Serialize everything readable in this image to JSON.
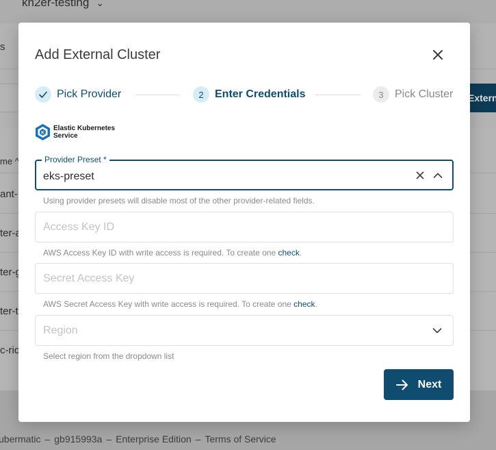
{
  "background": {
    "project_name": "kn2er-testing",
    "tab_partial": "s",
    "external_button_partial": "Extern",
    "column_header_partial": "me",
    "rows_partial": [
      "ant-",
      "ter-a",
      "ter-g",
      "ter-t",
      "c-ric"
    ],
    "footer": [
      "ubermatic",
      "gb915993a",
      "Enterprise Edition",
      "Terms of Service"
    ]
  },
  "dialog": {
    "title": "Add External Cluster",
    "steps": [
      {
        "number": "1",
        "label": "Pick Provider",
        "state": "done"
      },
      {
        "number": "2",
        "label": "Enter Credentials",
        "state": "active"
      },
      {
        "number": "3",
        "label": "Pick Cluster",
        "state": "pending"
      }
    ],
    "provider": {
      "name_line1": "Elastic Kubernetes",
      "name_line2": "Service",
      "icon": "eks-logo-icon"
    },
    "preset": {
      "label": "Provider Preset *",
      "value": "eks-preset",
      "hint": "Using provider presets will disable most of the other provider-related fields."
    },
    "access_key": {
      "placeholder": "Access Key ID",
      "hint": "AWS Access Key ID with write access is required. To create one ",
      "link": "check"
    },
    "secret_key": {
      "placeholder": "Secret Access Key",
      "hint": "AWS Secret Access Key with write access is required. To create one ",
      "link": "check"
    },
    "region": {
      "placeholder": "Region",
      "hint": "Select region from the dropdown list"
    },
    "next_label": "Next"
  },
  "colors": {
    "primary": "#0f4c70",
    "step_bg": "#d7edf5",
    "overlay": "#b3b3b3"
  }
}
